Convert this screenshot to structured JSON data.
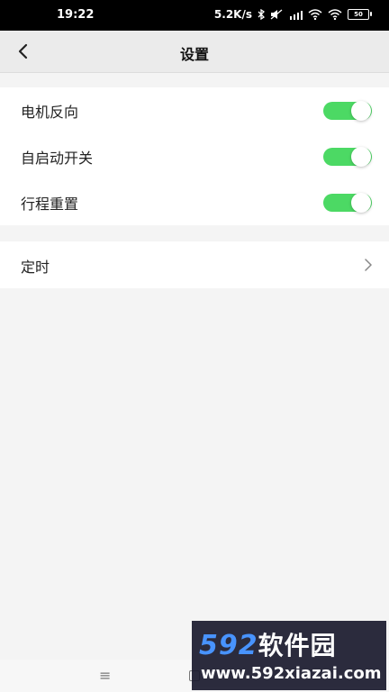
{
  "status_bar": {
    "time": "19:22",
    "network_speed": "5.2K/s",
    "icons": [
      "bluetooth-icon",
      "mute-icon",
      "hd-signal-icon",
      "wifi-icon",
      "wifi-icon",
      "battery-icon"
    ],
    "battery_level": "50"
  },
  "nav": {
    "title": "设置",
    "back_icon": "chevron-left-icon"
  },
  "settings": {
    "toggles": [
      {
        "label": "电机反向",
        "on": true
      },
      {
        "label": "自启动开关",
        "on": true
      },
      {
        "label": "行程重置",
        "on": true
      }
    ],
    "timer": {
      "label": "定时",
      "icon": "chevron-right-icon"
    }
  },
  "colors": {
    "toggle_on": "#4cd964",
    "background": "#f4f4f4",
    "card": "#ffffff"
  },
  "watermark": {
    "logo_digits": "592",
    "logo_text": "软件园",
    "url": "www.592xiazai.com"
  }
}
